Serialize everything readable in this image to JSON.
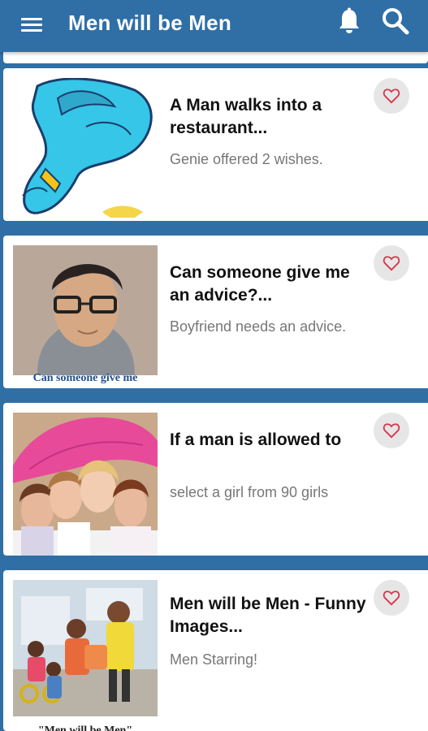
{
  "app": {
    "title": "Men will be Men",
    "bar_color": "#2f6fa6"
  },
  "toolbar": {
    "menu_icon": "menu-icon",
    "notifications_icon": "bell-icon",
    "search_icon": "search-icon"
  },
  "posts": [
    {
      "title": "A Man walks into a restaurant...",
      "subtitle": "Genie offered 2 wishes.",
      "image": "genie-illustration",
      "favorite_icon": "heart-outline-icon"
    },
    {
      "title": "Can someone give me an advice?...",
      "subtitle": "Boyfriend needs an advice.",
      "image": "young-man-with-glasses",
      "image_caption": "Can someone give me",
      "favorite_icon": "heart-outline-icon"
    },
    {
      "title": "If a man is allowed to",
      "subtitle": "select a girl from 90 girls",
      "image": "girls-under-pink-umbrella",
      "favorite_icon": "heart-outline-icon"
    },
    {
      "title": "Men will be Men - Funny Images...",
      "subtitle": "Men Starring!",
      "image": "kids-playing-outdoors",
      "image_caption": "\"Men will be Men\"",
      "favorite_icon": "heart-outline-icon"
    }
  ],
  "colors": {
    "accent": "#2f6fa6",
    "heart": "#d8344a",
    "fav_bg": "#e6e6e6"
  }
}
